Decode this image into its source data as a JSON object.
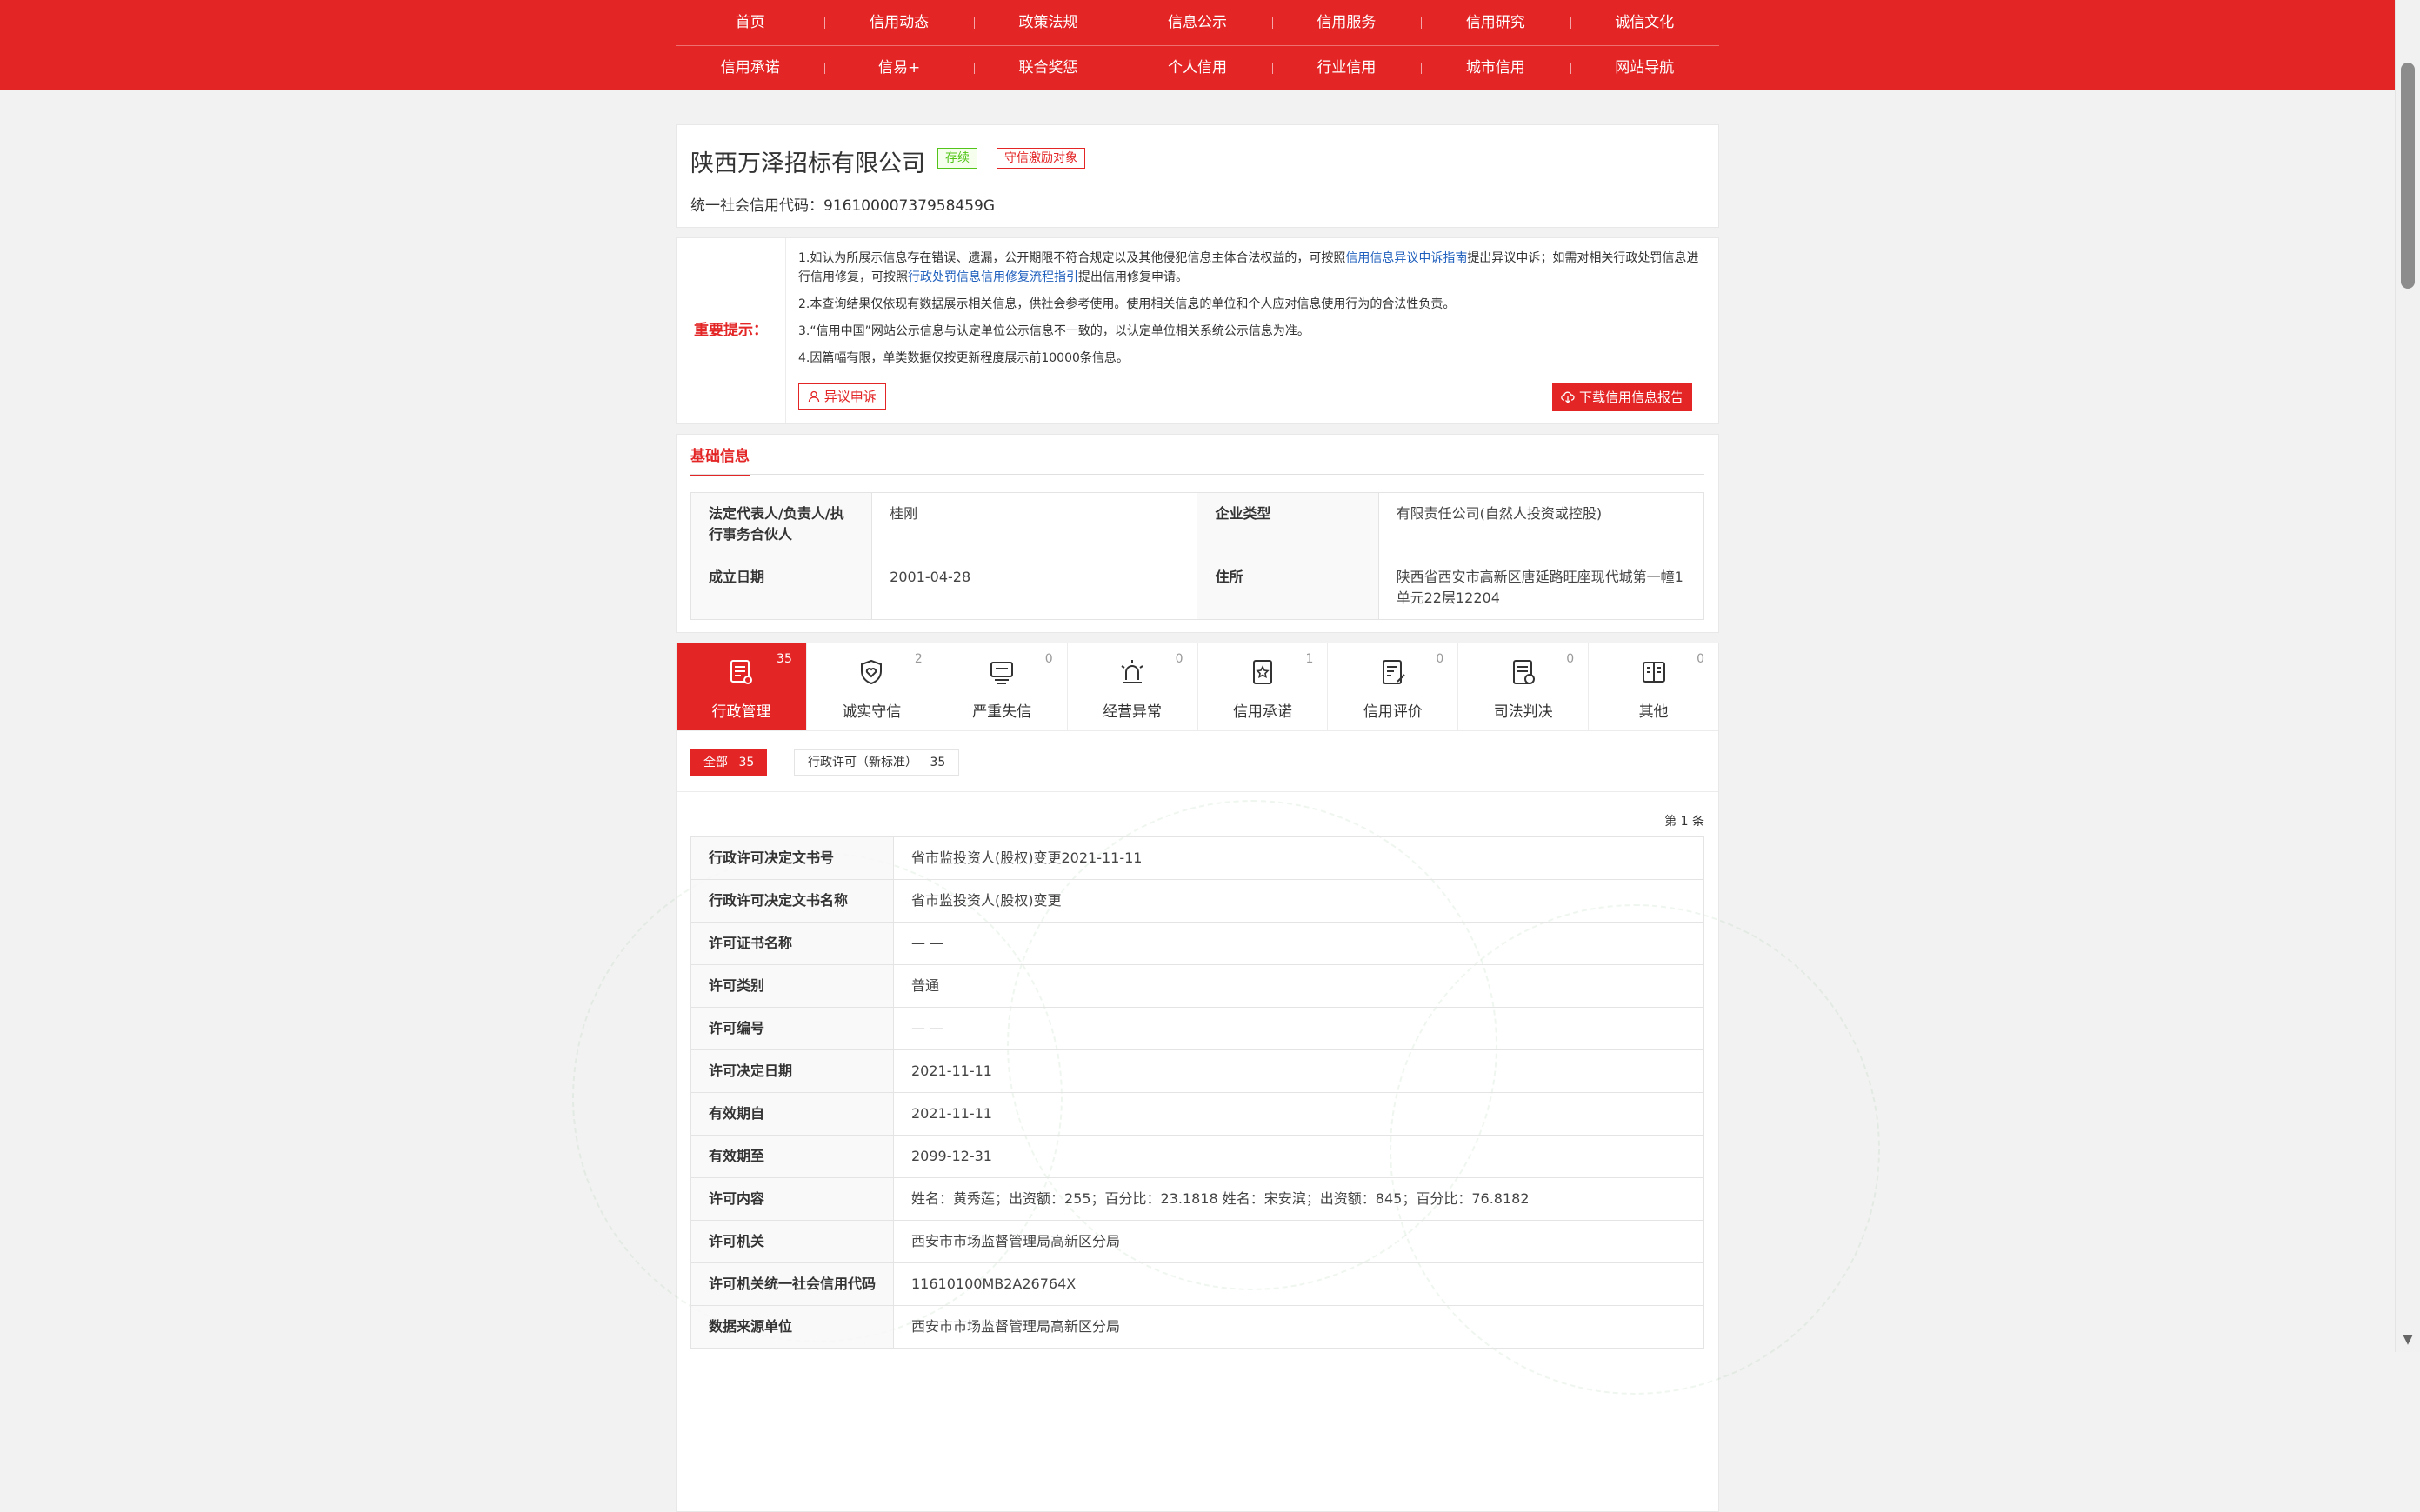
{
  "nav": {
    "row1": [
      "首页",
      "信用动态",
      "政策法规",
      "信息公示",
      "信用服务",
      "信用研究",
      "诚信文化"
    ],
    "row2": [
      "信用承诺",
      "信易+",
      "联合奖惩",
      "个人信用",
      "行业信用",
      "城市信用",
      "网站导航"
    ]
  },
  "company": {
    "name": "陕西万泽招标有限公司",
    "status_tag": "存续",
    "reward_tag": "守信激励对象",
    "credit_code": "统一社会信用代码：91610000737958459G"
  },
  "notice": {
    "label": "重要提示：",
    "item1_a": "1.如认为所展示信息存在错误、遗漏，公开期限不符合规定以及其他侵犯信息主体合法权益的，可按照",
    "item1_link1": "信用信息异议申诉指南",
    "item1_b": "提出异议申诉；如需对相关行政处罚信息进行信用修复，可按照",
    "item1_link2": "行政处罚信息信用修复流程指引",
    "item1_c": "提出信用修复申请。",
    "item2": "2.本查询结果仅依现有数据展示相关信息，供社会参考使用。使用相关信息的单位和个人应对信息使用行为的合法性负责。",
    "item3": "3.“信用中国”网站公示信息与认定单位公示信息不一致的，以认定单位相关系统公示信息为准。",
    "item4": "4.因篇幅有限，单类数据仅按更新程度展示前10000条信息。",
    "objection_button": "异议申诉",
    "download_button": "下载信用信息报告"
  },
  "basic": {
    "section_title": "基础信息",
    "rows": [
      {
        "k1": "法定代表人/负责人/执行事务合伙人",
        "v1": "桂刚",
        "k2": "企业类型",
        "v2": "有限责任公司(自然人投资或控股)"
      },
      {
        "k1": "成立日期",
        "v1": "2001-04-28",
        "k2": "住所",
        "v2": "陕西省西安市高新区唐延路旺座现代城第一幢1单元22层12204"
      }
    ]
  },
  "categories": [
    {
      "label": "行政管理",
      "count": "35",
      "icon": "admin-doc-icon"
    },
    {
      "label": "诚实守信",
      "count": "2",
      "icon": "shield-heart-icon"
    },
    {
      "label": "严重失信",
      "count": "0",
      "icon": "dishonest-person-icon"
    },
    {
      "label": "经营异常",
      "count": "0",
      "icon": "alarm-light-icon"
    },
    {
      "label": "信用承诺",
      "count": "1",
      "icon": "promise-doc-icon"
    },
    {
      "label": "信用评价",
      "count": "0",
      "icon": "evaluation-pen-icon"
    },
    {
      "label": "司法判决",
      "count": "0",
      "icon": "judgment-doc-icon"
    },
    {
      "label": "其他",
      "count": "0",
      "icon": "other-doc-icon"
    }
  ],
  "filters": {
    "all_label": "全部",
    "all_count": "35",
    "license_label": "行政许可（新标准）",
    "license_count": "35"
  },
  "page_count": "第 1 条",
  "detail_rows": [
    {
      "k": "行政许可决定文书号",
      "v": "省市监投资人(股权)变更2021-11-11"
    },
    {
      "k": "行政许可决定文书名称",
      "v": "省市监投资人(股权)变更"
    },
    {
      "k": "许可证书名称",
      "v": "— —"
    },
    {
      "k": "许可类别",
      "v": "普通"
    },
    {
      "k": "许可编号",
      "v": "— —"
    },
    {
      "k": "许可决定日期",
      "v": "2021-11-11"
    },
    {
      "k": "有效期自",
      "v": "2021-11-11"
    },
    {
      "k": "有效期至",
      "v": "2099-12-31"
    },
    {
      "k": "许可内容",
      "v": "姓名：黄秀莲；出资额：255；百分比：23.1818 姓名：宋安滨；出资额：845；百分比：76.8182"
    },
    {
      "k": "许可机关",
      "v": "西安市市场监督管理局高新区分局"
    },
    {
      "k": "许可机关统一社会信用代码",
      "v": "11610100MB2A26764X"
    },
    {
      "k": "数据来源单位",
      "v": "西安市市场监督管理局高新区分局"
    }
  ]
}
